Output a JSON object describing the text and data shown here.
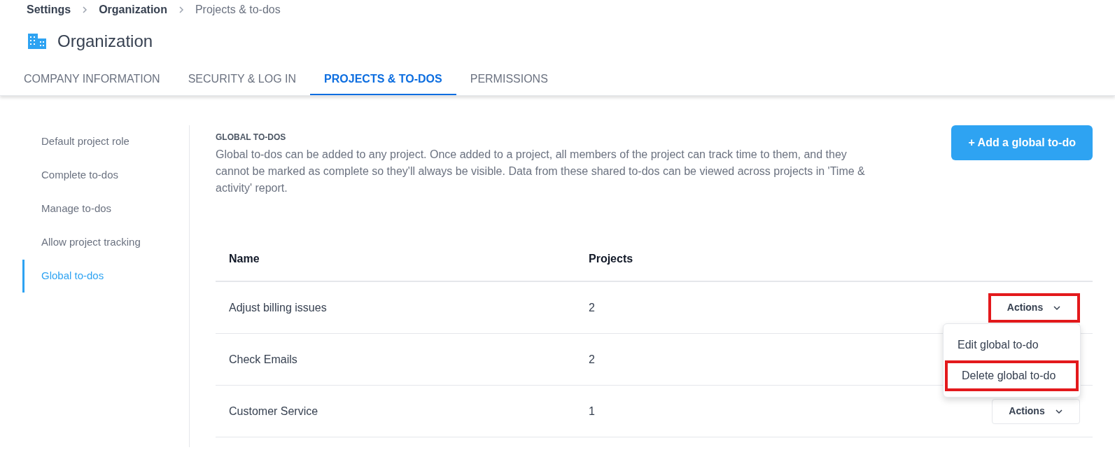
{
  "breadcrumb": [
    {
      "label": "Settings",
      "current": false
    },
    {
      "label": "Organization",
      "current": false
    },
    {
      "label": "Projects & to-dos",
      "current": true
    }
  ],
  "page_title": "Organization",
  "tabs": [
    {
      "label": "COMPANY INFORMATION",
      "selected": false
    },
    {
      "label": "SECURITY & LOG IN",
      "selected": false
    },
    {
      "label": "PROJECTS & TO-DOS",
      "selected": true
    },
    {
      "label": "PERMISSIONS",
      "selected": false
    }
  ],
  "sidebar": {
    "items": [
      {
        "label": "Default project role",
        "selected": false
      },
      {
        "label": "Complete to-dos",
        "selected": false
      },
      {
        "label": "Manage to-dos",
        "selected": false
      },
      {
        "label": "Allow project tracking",
        "selected": false
      },
      {
        "label": "Global to-dos",
        "selected": true
      }
    ]
  },
  "section": {
    "heading": "GLOBAL TO-DOS",
    "description": "Global to-dos can be added to any project. Once added to a project, all members of the project can track time to them, and they cannot be marked as complete so they'll always be visible. Data from these shared to-dos can be viewed across projects in 'Time & activity' report.",
    "add_button": "+ Add a global to-do"
  },
  "table": {
    "columns": [
      "Name",
      "Projects"
    ],
    "rows": [
      {
        "name": "Adjust billing issues",
        "projects": "2",
        "actions": {
          "label": "Actions",
          "highlighted": true
        },
        "menu": [
          {
            "label": "Edit global to-do",
            "highlighted": false
          },
          {
            "label": "Delete global to-do",
            "highlighted": true
          }
        ]
      },
      {
        "name": "Check Emails",
        "projects": "2"
      },
      {
        "name": "Customer Service",
        "projects": "1",
        "actions": {
          "label": "Actions",
          "highlighted": false
        }
      }
    ]
  }
}
